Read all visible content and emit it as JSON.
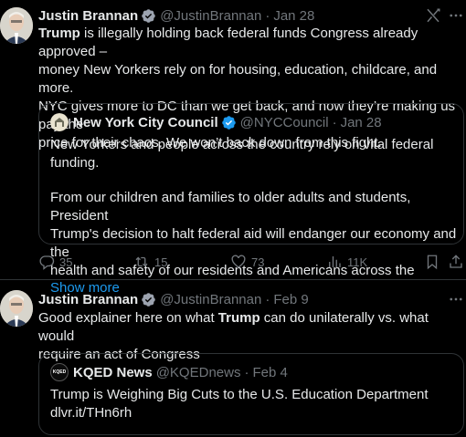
{
  "tweet1": {
    "author_name": "Justin Brannan",
    "author_handle": "@JustinBrannan",
    "separator": "·",
    "date": "Jan 28",
    "text_bold_lead": "Trump",
    "text_line1_rest": " is illegally holding back federal funds Congress already approved –",
    "text_line2": "money New Yorkers rely on for housing, education, childcare, and more.",
    "text_line3": "NYC gives more to DC than we get back, and now they’re making us pay the",
    "text_line4": "price for their chaos. We won’t back down from this fight.",
    "quote": {
      "author_name": "New York City Council",
      "author_handle": "@NYCCouncil",
      "date": "Jan 28",
      "line1": "New Yorkers and people across the country rely on vital federal funding.",
      "line2": "From our children and families to older adults and students, President",
      "line3": "Trump's decision to halt federal aid will endanger our economy and the",
      "line4": "health and safety of our residents and Americans across the",
      "show_more": "Show more"
    },
    "actions": {
      "replies": "35",
      "reposts": "15",
      "likes": "73",
      "views": "11K"
    }
  },
  "tweet2": {
    "author_name": "Justin Brannan",
    "author_handle": "@JustinBrannan",
    "separator": "·",
    "date": "Feb 9",
    "line1_pre": "Good explainer here on what ",
    "line1_bold": "Trump",
    "line1_post": " can do unilaterally vs. what would",
    "line2": "require an act of Congress",
    "quote": {
      "author_name": "KQED News",
      "author_handle": "@KQEDnews",
      "date": "Feb 4",
      "avatar_text": "KQED",
      "line1": "Trump is Weighing Big Cuts to the U.S. Education Department",
      "line2": "dlvr.it/THn6rh"
    }
  },
  "colors": {
    "background": "#000000",
    "text": "#e7e9ea",
    "muted": "#71767b",
    "accent": "#1d9bf0",
    "border": "#2f3336"
  },
  "icons": [
    "verified-badge-icon",
    "grok-icon",
    "more-icon",
    "reply-icon",
    "repost-icon",
    "like-icon",
    "views-icon",
    "bookmark-icon",
    "share-icon"
  ]
}
